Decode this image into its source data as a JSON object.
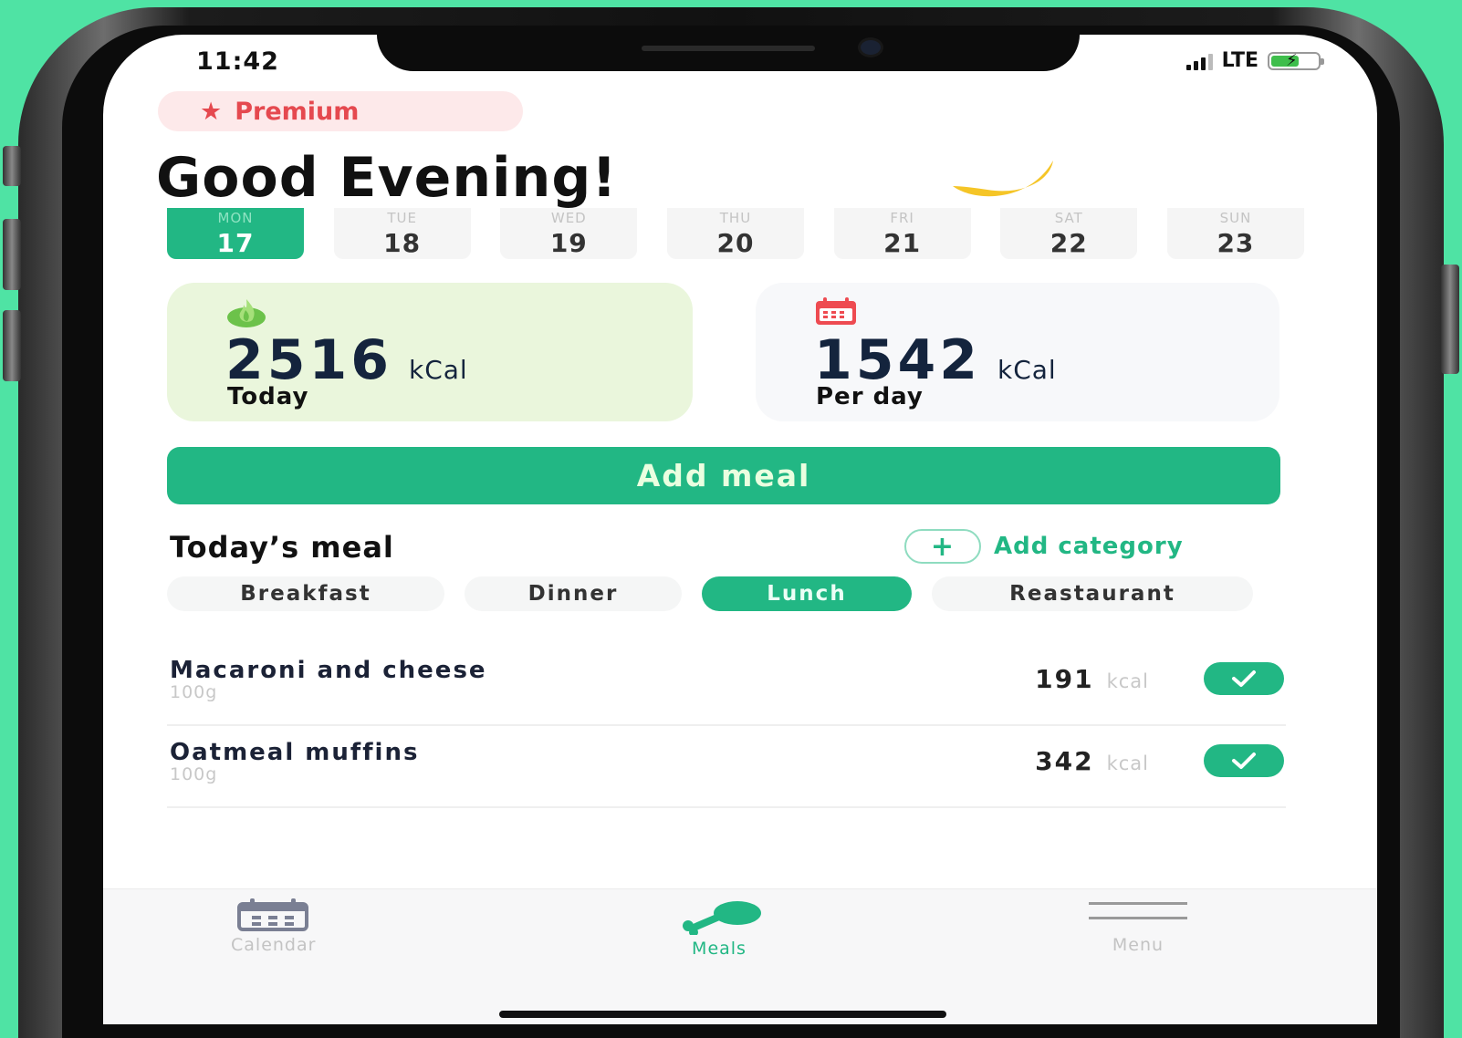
{
  "status": {
    "time": "11:42",
    "network": "LTE"
  },
  "premium": {
    "label": "Premium"
  },
  "greeting": {
    "text": "Good Evening!"
  },
  "week": [
    {
      "day": "MON",
      "date": "17",
      "selected": true
    },
    {
      "day": "TUE",
      "date": "18",
      "selected": false
    },
    {
      "day": "WED",
      "date": "19",
      "selected": false
    },
    {
      "day": "THU",
      "date": "20",
      "selected": false
    },
    {
      "day": "FRI",
      "date": "21",
      "selected": false
    },
    {
      "day": "SAT",
      "date": "22",
      "selected": false
    },
    {
      "day": "SUN",
      "date": "23",
      "selected": false
    }
  ],
  "stats": {
    "today": {
      "value": "2516",
      "unit": "kCal",
      "label": "Today"
    },
    "per_day": {
      "value": "1542",
      "unit": "kCal",
      "label": "Per day"
    }
  },
  "add_meal": {
    "label": "Add meal"
  },
  "meals_section": {
    "title": "Today’s meal",
    "add_category": "Add category"
  },
  "categories": [
    {
      "label": "Breakfast",
      "selected": false
    },
    {
      "label": "Dinner",
      "selected": false
    },
    {
      "label": "Lunch",
      "selected": true
    },
    {
      "label": "Reastaurant",
      "selected": false
    }
  ],
  "meals": [
    {
      "name": "Macaroni and cheese",
      "qty": "100g",
      "kcal": "191",
      "unit": "kcal",
      "checked": true
    },
    {
      "name": "Oatmeal muffins",
      "qty": "100g",
      "kcal": "342",
      "unit": "kcal",
      "checked": true
    }
  ],
  "tabs": [
    {
      "label": "Calendar",
      "icon": "calendar-icon",
      "active": false
    },
    {
      "label": "Meals",
      "icon": "drumstick-icon",
      "active": true
    },
    {
      "label": "Menu",
      "icon": "menu-icon",
      "active": false
    }
  ],
  "colors": {
    "accent": "#22b784",
    "premium": "#e5494f",
    "background": "#4fe3a4"
  }
}
